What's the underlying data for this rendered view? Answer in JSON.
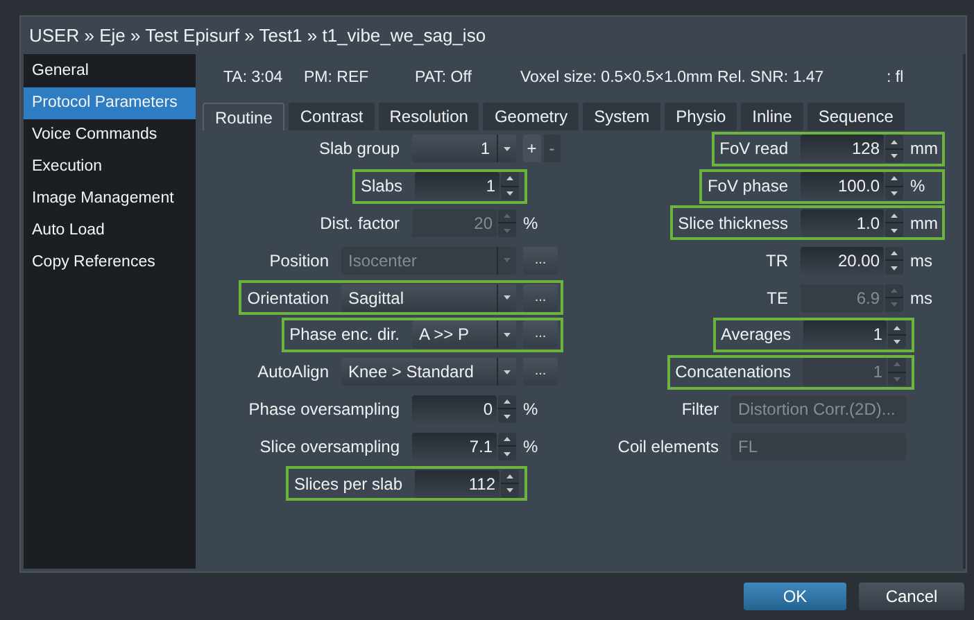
{
  "window": {
    "title": "USER » Eje » Test Episurf » Test1 » t1_vibe_we_sag_iso"
  },
  "sidebar": {
    "items": [
      {
        "label": "General",
        "selected": false
      },
      {
        "label": "Protocol Parameters",
        "selected": true
      },
      {
        "label": "Voice Commands",
        "selected": false
      },
      {
        "label": "Execution",
        "selected": false
      },
      {
        "label": "Image Management",
        "selected": false
      },
      {
        "label": "Auto Load",
        "selected": false
      },
      {
        "label": "Copy References",
        "selected": false
      }
    ]
  },
  "info": [
    "TA: 3:04",
    "PM: REF",
    "PAT: Off",
    "Voxel size: 0.5×0.5×1.0mm",
    "Rel. SNR: 1.47",
    ": fl"
  ],
  "tabs": [
    {
      "label": "Routine",
      "selected": true
    },
    {
      "label": "Contrast",
      "selected": false
    },
    {
      "label": "Resolution",
      "selected": false
    },
    {
      "label": "Geometry",
      "selected": false
    },
    {
      "label": "System",
      "selected": false
    },
    {
      "label": "Physio",
      "selected": false
    },
    {
      "label": "Inline",
      "selected": false
    },
    {
      "label": "Sequence",
      "selected": false
    }
  ],
  "left_rows": [
    {
      "kind": "number-dropdown",
      "label": "Slab group",
      "value": "1",
      "highlighted": false,
      "disabled": false,
      "buttons": [
        "+",
        "-"
      ]
    },
    {
      "kind": "spin",
      "label": "Slabs",
      "value": "1",
      "highlighted": true,
      "disabled": false
    },
    {
      "kind": "spin",
      "label": "Dist. factor",
      "value": "20",
      "unit": "%",
      "highlighted": false,
      "disabled": true
    },
    {
      "kind": "wide-dropdown",
      "label": "Position",
      "value": "Isocenter",
      "more": "...",
      "highlighted": false,
      "disabled": true
    },
    {
      "kind": "wide-dropdown",
      "label": "Orientation",
      "value": "Sagittal",
      "more": "...",
      "highlighted": true,
      "disabled": false
    },
    {
      "kind": "dropdown",
      "label": "Phase enc. dir.",
      "value": "A >> P",
      "more": "...",
      "highlighted": true,
      "disabled": false
    },
    {
      "kind": "wide-dropdown",
      "label": "AutoAlign",
      "value": "Knee > Standard",
      "more": "...",
      "highlighted": false,
      "disabled": false
    },
    {
      "kind": "spin",
      "label": "Phase oversampling",
      "value": "0",
      "unit": "%",
      "highlighted": false,
      "disabled": false
    },
    {
      "kind": "spin",
      "label": "Slice oversampling",
      "value": "7.1",
      "unit": "%",
      "highlighted": false,
      "disabled": false
    },
    {
      "kind": "spin",
      "label": "Slices per slab",
      "value": "112",
      "highlighted": true,
      "disabled": false
    }
  ],
  "right_rows": [
    {
      "kind": "spin",
      "label": "FoV read",
      "value": "128",
      "unit": "mm",
      "highlighted": true,
      "disabled": false
    },
    {
      "kind": "spin",
      "label": "FoV phase",
      "value": "100.0",
      "unit": "%",
      "highlighted": true,
      "disabled": false
    },
    {
      "kind": "spin",
      "label": "Slice thickness",
      "value": "1.0",
      "unit": "mm",
      "highlighted": true,
      "disabled": false
    },
    {
      "kind": "spin",
      "label": "TR",
      "value": "20.00",
      "unit": "ms",
      "highlighted": false,
      "disabled": false
    },
    {
      "kind": "spin",
      "label": "TE",
      "value": "6.9",
      "unit": "ms",
      "highlighted": false,
      "disabled": true
    },
    {
      "kind": "spin",
      "label": "Averages",
      "value": "1",
      "highlighted": true,
      "disabled": false
    },
    {
      "kind": "spin",
      "label": "Concatenations",
      "value": "1",
      "highlighted": true,
      "disabled": true
    },
    {
      "kind": "text",
      "label": "Filter",
      "value": "Distortion Corr.(2D)...",
      "highlighted": false,
      "disabled": true
    },
    {
      "kind": "text",
      "label": "Coil elements",
      "value": "FL",
      "highlighted": false,
      "disabled": true
    }
  ],
  "buttons": [
    {
      "label": "OK",
      "kind": "primary"
    },
    {
      "label": "Cancel",
      "kind": "secondary"
    }
  ]
}
